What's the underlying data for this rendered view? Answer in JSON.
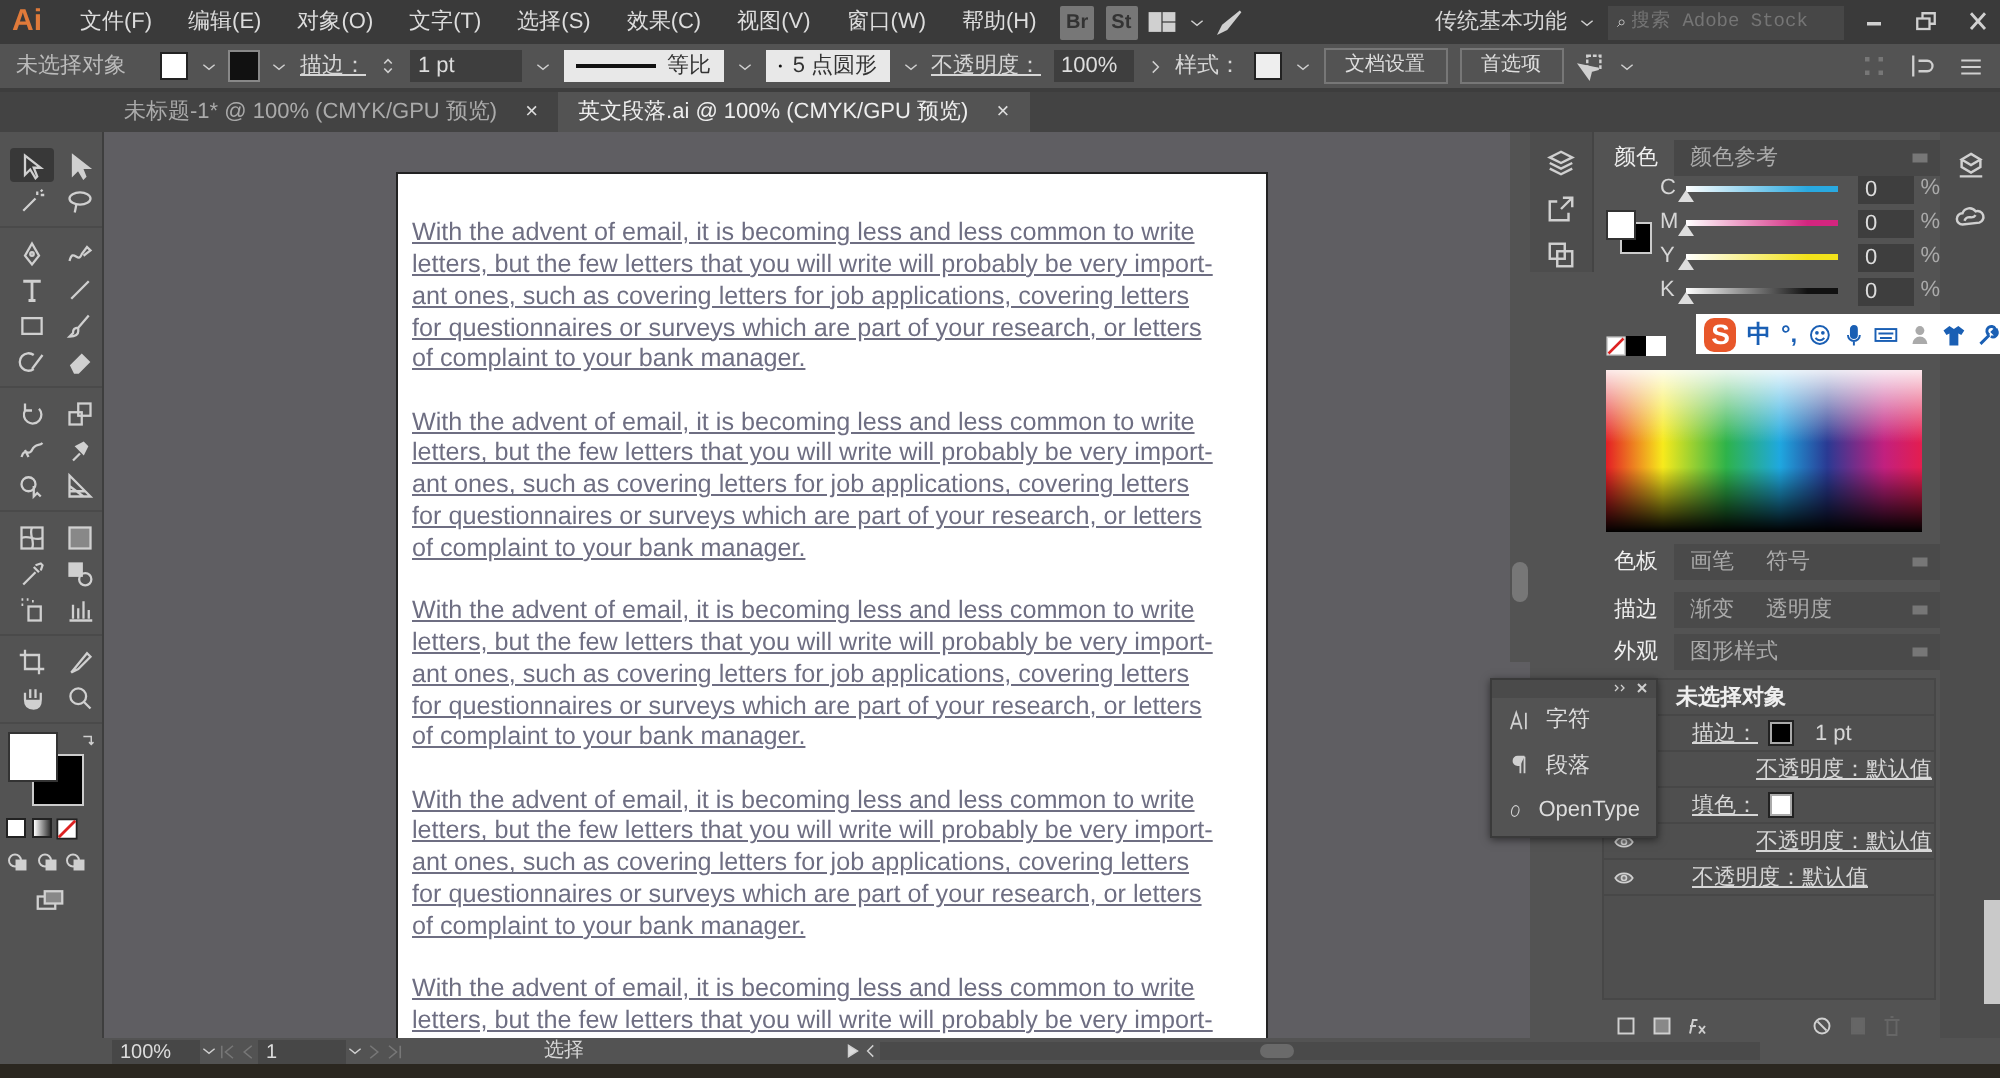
{
  "app_logo": "Ai",
  "menu": [
    "文件(F)",
    "编辑(E)",
    "对象(O)",
    "文字(T)",
    "选择(S)",
    "效果(C)",
    "视图(V)",
    "窗口(W)",
    "帮助(H)"
  ],
  "bridge_buttons": [
    "Br",
    "St"
  ],
  "workspace": "传统基本功能",
  "stock_search": {
    "placeholder": "搜索 Adobe Stock"
  },
  "control_bar": {
    "selection": "未选择对象",
    "stroke_label": "描边：",
    "stroke_weight": "1 pt",
    "profile": "等比",
    "brush": "5 点圆形",
    "opacity_label": "不透明度：",
    "opacity": "100%",
    "style_label": "样式：",
    "buttons": [
      "文档设置",
      "首选项"
    ]
  },
  "doc_tabs": [
    {
      "label": "未标题-1* @ 100% (CMYK/GPU 预览)",
      "close": "×",
      "selected": false
    },
    {
      "label": "英文段落.ai @ 100% (CMYK/GPU 预览)",
      "close": "×",
      "selected": true
    }
  ],
  "tools": [
    [
      {
        "selected": true
      },
      {
        "selected": false
      },
      {
        "selected": false
      },
      {
        "selected": false
      }
    ],
    [
      {
        "selected": false
      },
      {
        "selected": false
      },
      {
        "selected": false
      },
      {
        "selected": false
      },
      {
        "selected": false
      },
      {
        "selected": false
      },
      {
        "selected": false
      },
      {
        "selected": false
      }
    ],
    [
      {
        "selected": false
      },
      {
        "selected": false
      },
      {
        "selected": false
      },
      {
        "selected": false
      },
      {
        "selected": false
      },
      {
        "selected": false
      }
    ],
    [
      {
        "selected": false
      },
      {
        "selected": false
      },
      {
        "selected": false
      },
      {
        "selected": false
      },
      {
        "selected": false
      },
      {
        "selected": false
      }
    ],
    [
      {
        "selected": false
      },
      {
        "selected": false
      },
      {
        "selected": false
      },
      {
        "selected": false
      }
    ]
  ],
  "document": {
    "paragraphs": [
      {
        "lines": [
          "With the advent of email, it is becoming less and less common to write",
          "letters, but the few letters that you will write will probably be very import-",
          "ant ones, such as covering letters for job applications, covering letters",
          "for questionnaires or surveys which are part of your research, or letters",
          "of complaint to your bank manager."
        ]
      },
      {
        "lines": [
          "With the advent of email, it is becoming less and less common to write",
          "letters, but the few letters that you will write will probably be very import-",
          "ant ones, such as covering letters for job applications, covering letters",
          "for questionnaires or surveys which are part of your research, or letters",
          "of complaint to your bank manager."
        ]
      },
      {
        "lines": [
          "With the advent of email, it is becoming less and less common to write",
          "letters, but the few letters that you will write will probably be very import-",
          "ant ones, such as covering letters for job applications, covering letters",
          "for questionnaires or surveys which are part of your research, or letters",
          "of complaint to your bank manager."
        ]
      },
      {
        "lines": [
          "With the advent of email, it is becoming less and less common to write",
          "letters, but the few letters that you will write will probably be very import-",
          "ant ones, such as covering letters for job applications, covering letters",
          "for questionnaires or surveys which are part of your research, or letters",
          "of complaint to your bank manager."
        ]
      },
      {
        "lines": [
          "With the advent of email, it is becoming less and less common to write",
          "letters, but the few letters that you will write will probably be very import-"
        ]
      }
    ]
  },
  "status_bar": {
    "zoom": "100%",
    "page": "1",
    "tool": "选择"
  },
  "color_panel": {
    "tabs": [
      {
        "label": "颜色",
        "selected": true
      },
      {
        "label": "颜色参考",
        "selected": false
      }
    ],
    "channels": [
      {
        "label": "C",
        "level": 0,
        "value": "0",
        "unit": "%",
        "color": "#29a9e0"
      },
      {
        "label": "M",
        "level": 0,
        "value": "0",
        "unit": "%",
        "color": "#d4257f"
      },
      {
        "label": "Y",
        "level": 0,
        "value": "0",
        "unit": "%",
        "color": "#f2e21a"
      },
      {
        "label": "K",
        "level": 0,
        "value": "0",
        "unit": "%",
        "color": "#111111"
      }
    ]
  },
  "ime_bar": {
    "logo": "S",
    "mode": "中",
    "punct": "°,"
  },
  "swatch_tabs": [
    {
      "label": "色板",
      "selected": true
    },
    {
      "label": "画笔",
      "selected": false
    },
    {
      "label": "符号",
      "selected": false
    }
  ],
  "stroke_tabs": [
    {
      "label": "描边",
      "selected": true
    },
    {
      "label": "渐变",
      "selected": false
    },
    {
      "label": "透明度",
      "selected": false
    }
  ],
  "appearance_tabs": [
    {
      "label": "外观",
      "selected": true
    },
    {
      "label": "图形样式",
      "selected": false
    }
  ],
  "appearance": {
    "title": "未选择对象",
    "rows": [
      {
        "kind": "stroke",
        "label": "描边：",
        "color": "#000000",
        "value": "1 pt",
        "children": [
          {
            "kind": "opacity",
            "label": "不透明度：默认值"
          }
        ]
      },
      {
        "kind": "fill",
        "label": "填色：",
        "color": "#ffffff",
        "children": [
          {
            "kind": "opacity",
            "label": "不透明度：默认值"
          }
        ]
      },
      {
        "kind": "opacity",
        "label": "不透明度：默认值"
      }
    ]
  },
  "type_panel": {
    "items": [
      "字符",
      "段落",
      "OpenType"
    ]
  }
}
